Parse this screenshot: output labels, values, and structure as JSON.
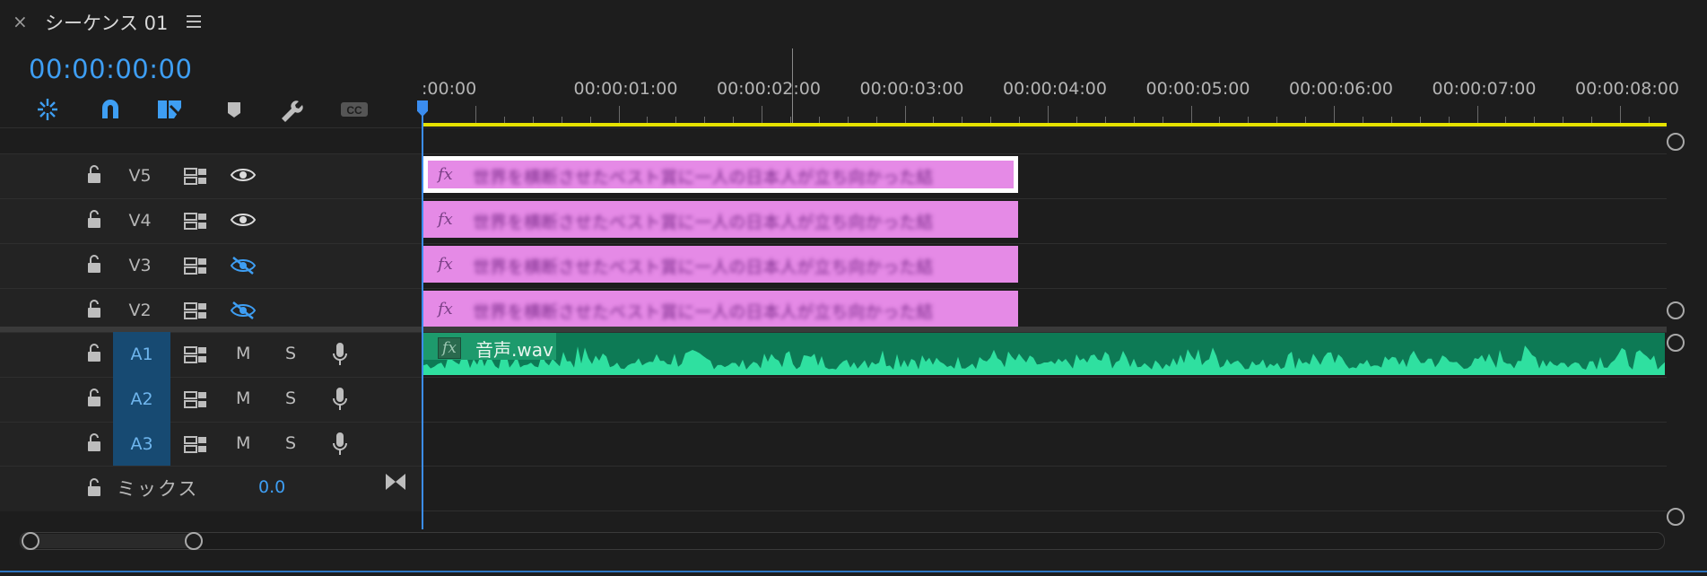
{
  "panel": {
    "close_icon": "×",
    "title": "シーケンス 01",
    "menu_icon": "hamburger-menu-icon"
  },
  "timecode": "00:00:00:00",
  "toolbar": {
    "tools": [
      "insert-overwrite-icon",
      "snap-magnet-icon",
      "linked-selection-icon",
      "marker-icon",
      "wrench-icon",
      "captions-icon"
    ],
    "captions_label": "CC"
  },
  "ruler": {
    "labels": [
      ":00:00",
      "00:00:01:00",
      "00:00:02:00",
      "00:00:03:00",
      "00:00:04:00",
      "00:00:05:00",
      "00:00:06:00",
      "00:00:07:00",
      "00:00:08:00"
    ]
  },
  "video_tracks": [
    {
      "name": "V5",
      "eye": "visible",
      "clip_text": "世界を横断させたベスト賞に一人の日本人が立ち向かった結"
    },
    {
      "name": "V4",
      "eye": "visible",
      "clip_text": "世界を横断させたベスト賞に一人の日本人が立ち向かった結"
    },
    {
      "name": "V3",
      "eye": "hidden",
      "clip_text": "世界を横断させたベスト賞に一人の日本人が立ち向かった結"
    },
    {
      "name": "V2",
      "eye": "hidden",
      "clip_text": "世界を横断させたベスト賞に一人の日本人が立ち向かった結"
    }
  ],
  "audio_tracks": [
    {
      "name": "A1",
      "mute": "M",
      "solo": "S"
    },
    {
      "name": "A2",
      "mute": "M",
      "solo": "S"
    },
    {
      "name": "A3",
      "mute": "M",
      "solo": "S"
    }
  ],
  "audio_clip": {
    "fx": "fx",
    "name": "音声.wav"
  },
  "video_clip_fx": "fx",
  "mix": {
    "label": "ミックス",
    "value": "0.0"
  },
  "colors": {
    "accent_blue": "#3e9ef3",
    "video_clip": "#e58ae6",
    "audio_clip": "#0d7a55",
    "waveform": "#2fe0a0",
    "work_area": "#e6e200",
    "audio_track_header": "#174a72"
  }
}
